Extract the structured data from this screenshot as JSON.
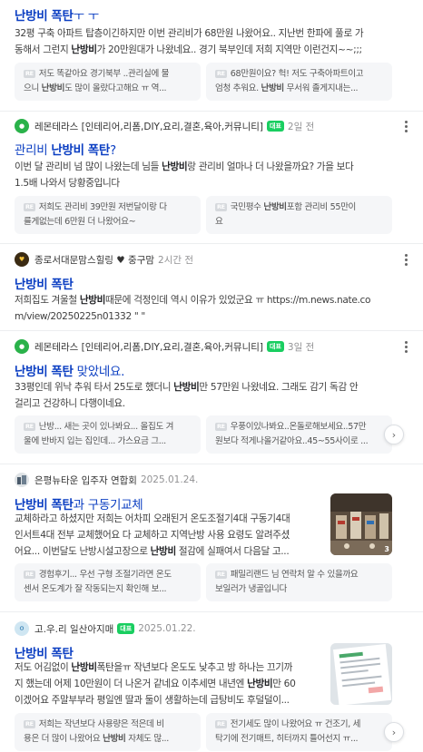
{
  "results": [
    {
      "title": "난방비 폭탄ㅜ ㅜ",
      "snippet_lines": [
        "32평 구축 아파트 탑층이긴하지만 이번 관리비가 68만원 나왔어요.. 지난번 한파에 풀로 가",
        "동해서 그런지 난방비가 20만원대가 나왔네요.. 경기 북부인데 저희 지역만 이런건지~~;;;"
      ],
      "replies": [
        {
          "lines": [
            "저도 똑같아요 경기북부 ..관리실에 물",
            "으니 난방비도 많이 올랐다고해요 ㅠ 역..."
          ]
        },
        {
          "lines": [
            "68만원이요? 헉! 저도 구축아파트이고",
            "엄청 추워요. 난방비 무서워 졸게지내는..."
          ]
        }
      ]
    },
    {
      "cafe": "레몬테라스 [인테리어,리폼,DIY,요리,결혼,육아,커뮤니티]",
      "badge": "대표",
      "time": "2일 전",
      "title": "관리비 난방비 폭탄?",
      "snippet_lines": [
        "이번 달 관리비 넘 많이 나왔는데 님들 난방비랑 관리비 얼마나 더 나왔을까요? 가을 보다",
        "1.5배 나와서 당황중입니다"
      ],
      "replies": [
        {
          "lines": [
            "저희도 관리비 39만원 저번달이랑 다",
            "를게없는데 6만원 더 나왔어요~"
          ]
        },
        {
          "lines": [
            "국민평수 난방비포함 관리비 55만이",
            "요"
          ]
        }
      ]
    },
    {
      "cafe": "종로서대문맘스힐링 ♥ 중구맘",
      "time": "2시간 전",
      "title": "난방비 폭탄",
      "snippet_lines": [
        "저희집도 겨울철 난방비때문에 걱정인데 역시 이유가 있었군요 ㅠ https://m.news.nate.co",
        "m/view/20250225n01332 \" \""
      ]
    },
    {
      "cafe": "레몬테라스 [인테리어,리폼,DIY,요리,결혼,육아,커뮤니티]",
      "badge": "대표",
      "time": "3일 전",
      "title": "난방비 폭탄 맞았네요.",
      "snippet_lines": [
        "33평인데 위낙 추워 타서 25도로 했더니 난방비만 57만원 나왔네요. 그래도 감기 독감 안",
        "걸리고 건강하니 다행이네요."
      ],
      "replies": [
        {
          "lines": [
            "난방... 새는 곳이 있나봐요... 올집도 겨",
            "울에 반바지 입는 집인데... 가스요금 그..."
          ]
        },
        {
          "lines": [
            "우풍이있나봐요..온돌로해보세요..57만",
            "원보다 적게나올거같아요..45~55사이로 ..."
          ]
        }
      ]
    },
    {
      "cafe": "은평뉴타운 입주자 연합회",
      "time": "2025.01.24.",
      "title": "난방비 폭탄과 구동기교체",
      "snippet_lines": [
        "교체하라고 하셨지만 저희는 어차피 오래된거 온도조절기4대 구동기4대",
        "인서트4대 전부 교체했어요 다 교체하고 지역난방 사용 요령도 알려주셨",
        "어요... 이번달도 난방시설고장으로 난방비 절감에 실패여서 다음달 고..."
      ],
      "thumb_count": "3",
      "replies": [
        {
          "lines": [
            "경험후기... 우선 구형 조절기라면 온도",
            "센서 온도계가 잘 작동되는지 확인해 보..."
          ]
        },
        {
          "lines": [
            "패밀리랜드 님 연락처 알 수 있을까요",
            "보일러가 냉골입니다"
          ]
        }
      ]
    },
    {
      "cafe": "고.우.리 일산아지매",
      "badge": "대표",
      "time": "2025.01.22.",
      "title": "난방비 폭탄",
      "snippet_lines": [
        "저도 어김없이 난방비폭탄을ㅠ 작년보다 온도도 낮추고 방 하나는 끄기까",
        "지 했는데 어제 10만원이 더 나온거 같네요 이추세면 내년엔 난방비만 60",
        "이겠어요 주말부부라 평일엔 딸과 둘이 생활하는데 급탕비도 후덜덜이..."
      ],
      "replies": [
        {
          "lines": [
            "저희는 작년보다 사용량은 적은데 비",
            "용은 더 많이 나왔어요 난방비 자체도 많..."
          ]
        },
        {
          "lines": [
            "전기세도 많이 나왔어요 ㅠ 건조기, 세",
            "탁기에 전기매트, 히터까지 틀어선지 ㅠ..."
          ]
        }
      ]
    }
  ],
  "labels": {
    "re": "RE",
    "arrow": "›"
  },
  "colors": {
    "title": "#0b3ec2",
    "badge": "#19ce60",
    "reply_bg": "#f5f6f8"
  },
  "icons": {
    "more": "more-vertical-icon",
    "next": "chevron-right-icon"
  }
}
